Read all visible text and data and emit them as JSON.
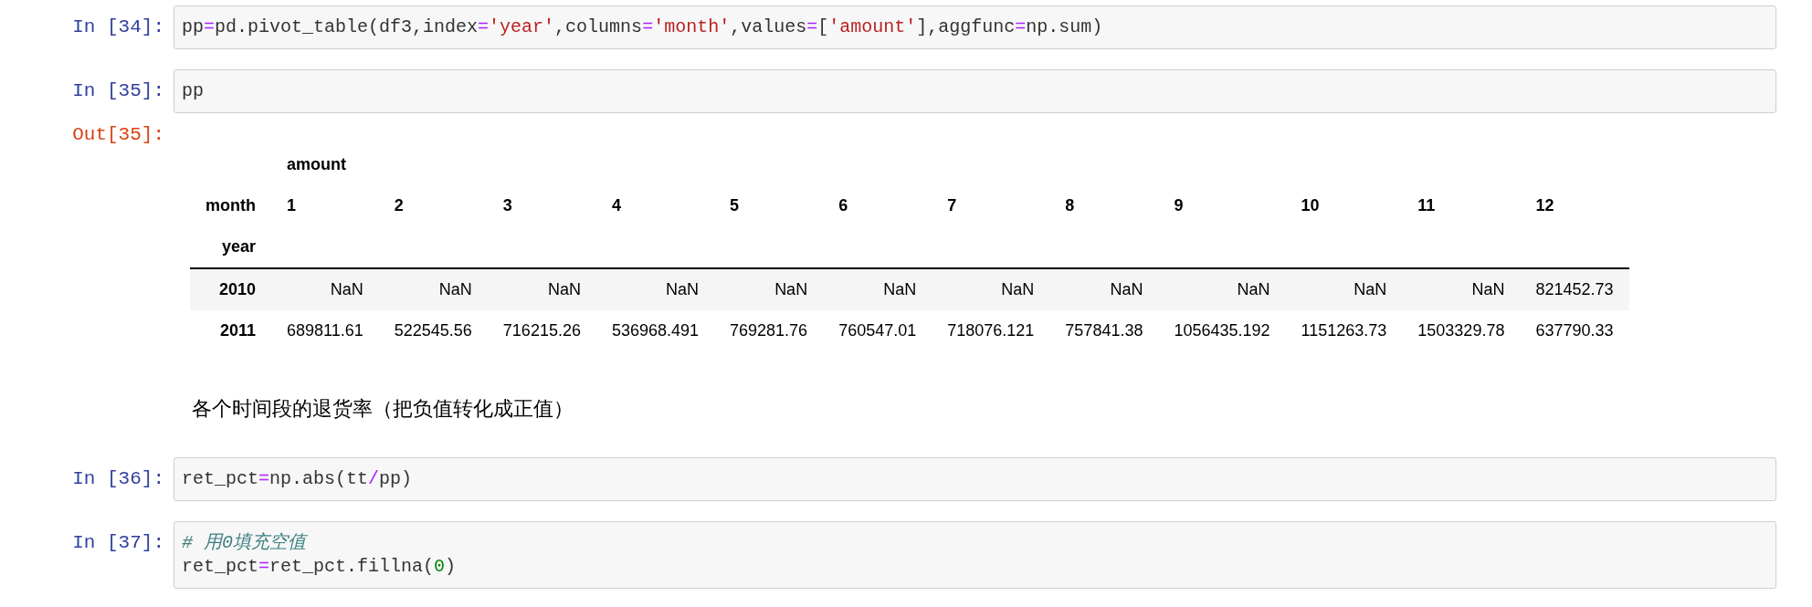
{
  "cells": [
    {
      "kind": "code",
      "prompt": "In [34]:",
      "lines": [
        [
          {
            "kind": "plain",
            "t": "pp"
          },
          {
            "kind": "op",
            "t": "="
          },
          {
            "kind": "plain",
            "t": "pd.pivot_table(df3,index"
          },
          {
            "kind": "op",
            "t": "="
          },
          {
            "kind": "str",
            "t": "'year'"
          },
          {
            "kind": "plain",
            "t": ",columns"
          },
          {
            "kind": "op",
            "t": "="
          },
          {
            "kind": "str",
            "t": "'month'"
          },
          {
            "kind": "plain",
            "t": ",values"
          },
          {
            "kind": "op",
            "t": "="
          },
          {
            "kind": "plain",
            "t": "["
          },
          {
            "kind": "str",
            "t": "'amount'"
          },
          {
            "kind": "plain",
            "t": "],aggfunc"
          },
          {
            "kind": "op",
            "t": "="
          },
          {
            "kind": "plain",
            "t": "np.sum)"
          }
        ]
      ]
    },
    {
      "kind": "code",
      "prompt": "In [35]:",
      "lines": [
        [
          {
            "kind": "plain",
            "t": "pp"
          }
        ]
      ],
      "output": {
        "prompt": "Out[35]:",
        "table": {
          "top_header": "amount",
          "column_index_name": "month",
          "columns": [
            "1",
            "2",
            "3",
            "4",
            "5",
            "6",
            "7",
            "8",
            "9",
            "10",
            "11",
            "12"
          ],
          "row_index_name": "year",
          "rows": [
            {
              "index": "2010",
              "values": [
                "NaN",
                "NaN",
                "NaN",
                "NaN",
                "NaN",
                "NaN",
                "NaN",
                "NaN",
                "NaN",
                "NaN",
                "NaN",
                "821452.73"
              ]
            },
            {
              "index": "2011",
              "values": [
                "689811.61",
                "522545.56",
                "716215.26",
                "536968.491",
                "769281.76",
                "760547.01",
                "718076.121",
                "757841.38",
                "1056435.192",
                "1151263.73",
                "1503329.78",
                "637790.33"
              ]
            }
          ]
        }
      }
    },
    {
      "kind": "markdown",
      "text": "各个时间段的退货率（把负值转化成正值）"
    },
    {
      "kind": "code",
      "prompt": "In [36]:",
      "lines": [
        [
          {
            "kind": "plain",
            "t": "ret_pct"
          },
          {
            "kind": "op",
            "t": "="
          },
          {
            "kind": "plain",
            "t": "np.abs(tt"
          },
          {
            "kind": "op",
            "t": "/"
          },
          {
            "kind": "plain",
            "t": "pp)"
          }
        ]
      ]
    },
    {
      "kind": "code",
      "prompt": "In [37]:",
      "lines": [
        [
          {
            "kind": "comment",
            "t": "# 用0填充空值"
          }
        ],
        [
          {
            "kind": "plain",
            "t": "ret_pct"
          },
          {
            "kind": "op",
            "t": "="
          },
          {
            "kind": "plain",
            "t": "ret_pct.fillna("
          },
          {
            "kind": "num",
            "t": "0"
          },
          {
            "kind": "plain",
            "t": ")"
          }
        ]
      ]
    }
  ]
}
